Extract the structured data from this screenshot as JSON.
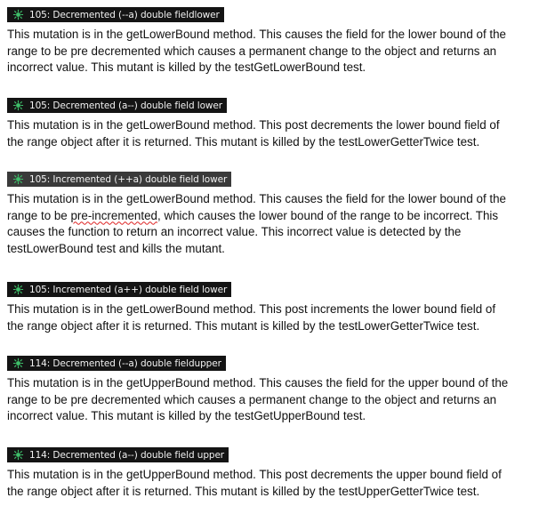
{
  "mutations": [
    {
      "header": "105: Decremented (--a) double fieldlower",
      "lines": [
        "This mutation is in the getLowerBound method. This causes the field for the lower bound of the",
        "range to be pre decremented which causes a permanent change to the object and returns an",
        "incorrect value. This mutant is killed by the testGetLowerBound test."
      ]
    },
    {
      "header": "105: Decremented (a--) double field lower",
      "lines": [
        "This mutation is in the getLowerBound method. This post decrements the lower bound field of",
        "the range object after it is returned. This mutant is killed by the testLowerGetterTwice test."
      ]
    },
    {
      "header": "105: Incremented (++a) double field lower",
      "lines": [
        "This mutation is in the getLowerBound method. This causes the field for the lower bound of the",
        "range to be ",
        "pre-incremented",
        ", which causes the lower bound of the range to be incorrect. This",
        "causes the function to return an incorrect value. This incorrect value is detected by the",
        "testLowerBound test and kills the mutant."
      ]
    },
    {
      "header": "105: Incremented (a++) double field lower",
      "lines": [
        "This mutation is in the getLowerBound method. This post increments the lower bound field of",
        "the range object after it is returned. This mutant is killed by the testLowerGetterTwice test."
      ]
    },
    {
      "header": "114: Decremented (--a) double fieldupper",
      "lines": [
        "This mutation is in the getUpperBound method. This causes the field for the upper bound of the",
        "range to be pre decremented which causes a permanent change to the object and returns an",
        "incorrect value. This mutant is killed by the testGetUpperBound test."
      ]
    },
    {
      "header": "114: Decremented (a--) double field upper",
      "lines": [
        "This mutation is in the getUpperBound method. This post decrements the upper bound field of",
        "the range object after it is returned. This mutant is killed by the testUpperGetterTwice test."
      ]
    }
  ],
  "colors": {
    "header_bg": "#141414",
    "header_text": "#f2f2f2",
    "icon": "#3fbf6a",
    "squiggle": "#dd2222"
  },
  "icon_name": "mutant-bug-icon"
}
